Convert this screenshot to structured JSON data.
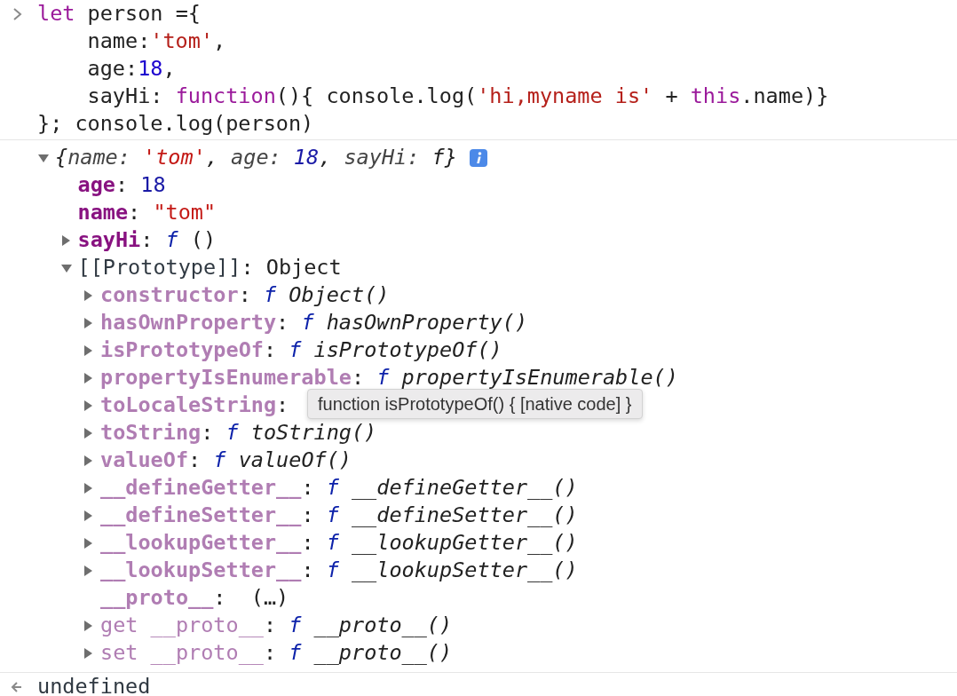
{
  "input": {
    "lines": [
      {
        "indented": false,
        "segments": [
          {
            "kind": "keyword",
            "text": "let"
          },
          {
            "kind": "plain",
            "text": " person ={"
          }
        ]
      },
      {
        "indented": true,
        "segments": [
          {
            "kind": "plain",
            "text": "name:"
          },
          {
            "kind": "string",
            "text": "'tom'"
          },
          {
            "kind": "plain",
            "text": ","
          }
        ]
      },
      {
        "indented": true,
        "segments": [
          {
            "kind": "plain",
            "text": "age:"
          },
          {
            "kind": "number",
            "text": "18"
          },
          {
            "kind": "plain",
            "text": ","
          }
        ]
      },
      {
        "indented": true,
        "segments": [
          {
            "kind": "plain",
            "text": "sayHi: "
          },
          {
            "kind": "keyword",
            "text": "function"
          },
          {
            "kind": "plain",
            "text": "(){ console.log("
          },
          {
            "kind": "string",
            "text": "'hi,myname is'"
          },
          {
            "kind": "plain",
            "text": " + "
          },
          {
            "kind": "keyword",
            "text": "this"
          },
          {
            "kind": "plain",
            "text": ".name)}"
          }
        ]
      },
      {
        "indented": false,
        "segments": [
          {
            "kind": "plain",
            "text": "}; console.log(person)"
          }
        ]
      }
    ]
  },
  "output": {
    "tree": {
      "expanded": true,
      "segments": [
        {
          "kind": "pplain",
          "text": "{"
        },
        {
          "kind": "pkey",
          "text": "name: "
        },
        {
          "kind": "pstr",
          "text": "'tom'"
        },
        {
          "kind": "pplain",
          "text": ", "
        },
        {
          "kind": "pkey",
          "text": "age: "
        },
        {
          "kind": "pnum",
          "text": "18"
        },
        {
          "kind": "pplain",
          "text": ", "
        },
        {
          "kind": "pkey",
          "text": "sayHi: "
        },
        {
          "kind": "pplain",
          "text": "f}"
        }
      ],
      "children": [
        {
          "segments": [
            {
              "kind": "own",
              "text": "age"
            },
            {
              "kind": "plain",
              "text": ": "
            },
            {
              "kind": "vnum",
              "text": "18"
            }
          ]
        },
        {
          "segments": [
            {
              "kind": "own",
              "text": "name"
            },
            {
              "kind": "plain",
              "text": ": "
            },
            {
              "kind": "vstr",
              "text": "\"tom\""
            }
          ]
        },
        {
          "expanded": false,
          "segments": [
            {
              "kind": "own",
              "text": "sayHi"
            },
            {
              "kind": "plain",
              "text": ": "
            },
            {
              "kind": "fn",
              "text": "f"
            },
            {
              "kind": "plain",
              "text": " ()"
            }
          ]
        },
        {
          "expanded": true,
          "segments": [
            {
              "kind": "internal",
              "text": "[[Prototype]]"
            },
            {
              "kind": "plain",
              "text": ": Object"
            }
          ],
          "children": [
            {
              "expanded": false,
              "segments": [
                {
                  "kind": "inherited",
                  "text": "constructor"
                },
                {
                  "kind": "plain",
                  "text": ": "
                },
                {
                  "kind": "fn",
                  "text": "f"
                },
                {
                  "kind": "fname",
                  "text": " Object()"
                }
              ]
            },
            {
              "expanded": false,
              "segments": [
                {
                  "kind": "inherited",
                  "text": "hasOwnProperty"
                },
                {
                  "kind": "plain",
                  "text": ": "
                },
                {
                  "kind": "fn",
                  "text": "f"
                },
                {
                  "kind": "fname",
                  "text": " hasOwnProperty()"
                }
              ]
            },
            {
              "expanded": false,
              "segments": [
                {
                  "kind": "inherited",
                  "text": "isPrototypeOf"
                },
                {
                  "kind": "plain",
                  "text": ": "
                },
                {
                  "kind": "fn",
                  "text": "f"
                },
                {
                  "kind": "fname",
                  "text": " isPrototypeOf()"
                }
              ]
            },
            {
              "expanded": false,
              "segments": [
                {
                  "kind": "inherited",
                  "text": "propertyIsEnumerable"
                },
                {
                  "kind": "plain",
                  "text": ": "
                },
                {
                  "kind": "fn",
                  "text": "f"
                },
                {
                  "kind": "fname",
                  "text": " propertyIsEnumerable()"
                }
              ]
            },
            {
              "expanded": false,
              "segments": [
                {
                  "kind": "inherited",
                  "text": "toLocaleString"
                },
                {
                  "kind": "plain",
                  "text": ":"
                }
              ],
              "tooltip": {
                "text": "function isPrototypeOf() { [native code] }"
              }
            },
            {
              "expanded": false,
              "segments": [
                {
                  "kind": "inherited",
                  "text": "toString"
                },
                {
                  "kind": "plain",
                  "text": ": "
                },
                {
                  "kind": "fn",
                  "text": "f"
                },
                {
                  "kind": "fname",
                  "text": " toString()"
                }
              ]
            },
            {
              "expanded": false,
              "segments": [
                {
                  "kind": "inherited",
                  "text": "valueOf"
                },
                {
                  "kind": "plain",
                  "text": ": "
                },
                {
                  "kind": "fn",
                  "text": "f"
                },
                {
                  "kind": "fname",
                  "text": " valueOf()"
                }
              ]
            },
            {
              "expanded": false,
              "segments": [
                {
                  "kind": "inherited",
                  "text": "__defineGetter__"
                },
                {
                  "kind": "plain",
                  "text": ": "
                },
                {
                  "kind": "fn",
                  "text": "f"
                },
                {
                  "kind": "fname",
                  "text": " __defineGetter__()"
                }
              ]
            },
            {
              "expanded": false,
              "segments": [
                {
                  "kind": "inherited",
                  "text": "__defineSetter__"
                },
                {
                  "kind": "plain",
                  "text": ": "
                },
                {
                  "kind": "fn",
                  "text": "f"
                },
                {
                  "kind": "fname",
                  "text": " __defineSetter__()"
                }
              ]
            },
            {
              "expanded": false,
              "segments": [
                {
                  "kind": "inherited",
                  "text": "__lookupGetter__"
                },
                {
                  "kind": "plain",
                  "text": ": "
                },
                {
                  "kind": "fn",
                  "text": "f"
                },
                {
                  "kind": "fname",
                  "text": " __lookupGetter__()"
                }
              ]
            },
            {
              "expanded": false,
              "segments": [
                {
                  "kind": "inherited",
                  "text": "__lookupSetter__"
                },
                {
                  "kind": "plain",
                  "text": ": "
                },
                {
                  "kind": "fn",
                  "text": "f"
                },
                {
                  "kind": "fname",
                  "text": " __lookupSetter__()"
                }
              ]
            },
            {
              "segments": [
                {
                  "kind": "inherited",
                  "text": "__proto__"
                },
                {
                  "kind": "plain",
                  "text": ":  (…)"
                }
              ]
            },
            {
              "expanded": false,
              "segments": [
                {
                  "kind": "accessor",
                  "text": "get __proto__"
                },
                {
                  "kind": "plain",
                  "text": ": "
                },
                {
                  "kind": "fn",
                  "text": "f"
                },
                {
                  "kind": "fname",
                  "text": " __proto__()"
                }
              ]
            },
            {
              "expanded": false,
              "segments": [
                {
                  "kind": "accessor",
                  "text": "set __proto__"
                },
                {
                  "kind": "plain",
                  "text": ": "
                },
                {
                  "kind": "fn",
                  "text": "f"
                },
                {
                  "kind": "fname",
                  "text": " __proto__()"
                }
              ]
            }
          ]
        }
      ]
    }
  },
  "result": {
    "text": "undefined"
  }
}
